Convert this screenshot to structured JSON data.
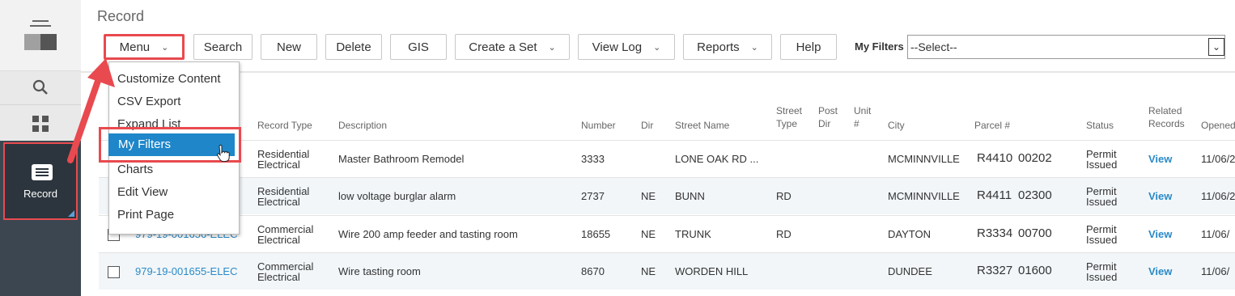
{
  "rail": {
    "record_label": "Record"
  },
  "page": {
    "title": "Record"
  },
  "toolbar": {
    "buttons": [
      {
        "label": "Menu",
        "chev": "⌄"
      },
      {
        "label": "Search"
      },
      {
        "label": "New"
      },
      {
        "label": "Delete"
      },
      {
        "label": "GIS"
      },
      {
        "label": "Create a Set",
        "chev": "⌄"
      },
      {
        "label": "View Log",
        "chev": "⌄"
      },
      {
        "label": "Reports",
        "chev": "⌄"
      },
      {
        "label": "Help"
      }
    ],
    "filters_label": "My Filters",
    "filters_value": "--Select--"
  },
  "menu": {
    "items": [
      "Customize Content",
      "CSV Export",
      "Expand List",
      "My Filters",
      "Charts",
      "Edit View",
      "Print Page"
    ]
  },
  "table": {
    "headers": {
      "record_type": "Record Type",
      "description": "Description",
      "number": "Number",
      "dir": "Dir",
      "street_name": "Street Name",
      "street_type_1": "Street",
      "street_type_2": "Type",
      "post_dir_1": "Post",
      "post_dir_2": "Dir",
      "unit_1": "Unit",
      "unit_2": "#",
      "city": "City",
      "parcel": "Parcel #",
      "status": "Status",
      "related_1": "Related",
      "related_2": "Records",
      "opened": "Opened"
    },
    "rows": [
      {
        "record": "",
        "type_1": "Residential",
        "type_2": "Electrical",
        "description": "Master Bathroom Remodel",
        "number": "3333",
        "dir": "",
        "street": "LONE OAK RD ...",
        "street_type": "",
        "city": "MCMINNVILLE",
        "parcel_a": "R4410",
        "parcel_b": "00202",
        "status_1": "Permit",
        "status_2": "Issued",
        "related": "View",
        "opened": "11/06/2"
      },
      {
        "record": "",
        "type_1": "Residential",
        "type_2": "Electrical",
        "description": "low voltage burglar alarm",
        "number": "2737",
        "dir": "NE",
        "street": "BUNN",
        "street_type": "RD",
        "city": "MCMINNVILLE",
        "parcel_a": "R4411",
        "parcel_b": "02300",
        "status_1": "Permit",
        "status_2": "Issued",
        "related": "View",
        "opened": "11/06/2"
      },
      {
        "record": "979-19-001656-ELEC",
        "type_1": "Commercial",
        "type_2": "Electrical",
        "description": "Wire 200 amp feeder and tasting room",
        "number": "18655",
        "dir": "NE",
        "street": "TRUNK",
        "street_type": "RD",
        "city": "DAYTON",
        "parcel_a": "R3334",
        "parcel_b": "00700",
        "status_1": "Permit",
        "status_2": "Issued",
        "related": "View",
        "opened": "11/06/"
      },
      {
        "record": "979-19-001655-ELEC",
        "type_1": "Commercial",
        "type_2": "Electrical",
        "description": "Wire tasting room",
        "number": "8670",
        "dir": "NE",
        "street": "WORDEN HILL",
        "street_type": "",
        "city": "DUNDEE",
        "parcel_a": "R3327",
        "parcel_b": "01600",
        "status_1": "Permit",
        "status_2": "Issued",
        "related": "View",
        "opened": "11/06/"
      }
    ]
  },
  "colors": {
    "accent": "#1e86c9",
    "link": "#2a8ac7",
    "highlight_border": "#e84a4f",
    "rail": "#3b4650"
  }
}
